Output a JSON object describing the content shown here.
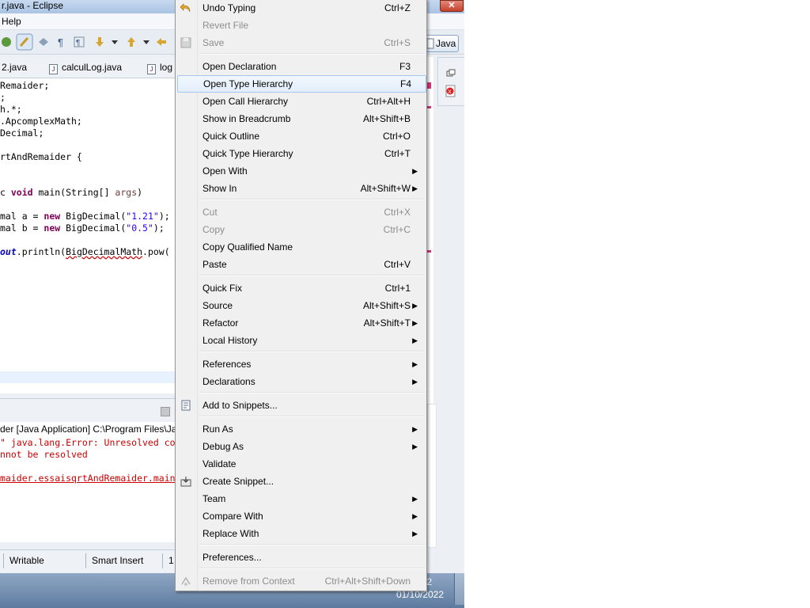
{
  "window": {
    "title": "r.java - Eclipse",
    "close_glyph": "✕"
  },
  "menubar": {
    "help": "Help"
  },
  "toolbar": {
    "perspective_label": "Java"
  },
  "editor_tabs": [
    {
      "label": "2.java"
    },
    {
      "label": "calculLog.java"
    },
    {
      "label": "log"
    }
  ],
  "editor": {
    "lines": [
      "Remaider;",
      ";",
      "h.*;",
      ".ApcomplexMath;",
      "Decimal;",
      "",
      "rtAndRemaider {",
      "",
      "",
      "c void main(String[] args)",
      "",
      "mal a = new BigDecimal(\"1.21\");",
      "mal b = new BigDecimal(\"0.5\");",
      "",
      "out.println(BigDecimalMath.pow("
    ]
  },
  "console": {
    "process": "der [Java Application] C:\\Program Files\\Ja",
    "lines": [
      "\" java.lang.Error: Unresolved co",
      "nnot be resolved",
      "",
      "maider.essaisqrtAndRemaider.main"
    ]
  },
  "statusbar": {
    "writable": "Writable",
    "insert_mode": "Smart Insert",
    "position": "1"
  },
  "clock": {
    "time": "2",
    "date": "01/10/2022"
  },
  "context_menu": {
    "items": [
      {
        "label": "Undo Typing",
        "shortcut": "Ctrl+Z",
        "icon": "undo-icon"
      },
      {
        "label": "Revert File",
        "shortcut": "",
        "disabled": true
      },
      {
        "label": "Save",
        "shortcut": "Ctrl+S",
        "disabled": true,
        "icon": "save-icon"
      },
      {
        "label": "Open Declaration",
        "shortcut": "F3"
      },
      {
        "label": "Open Type Hierarchy",
        "shortcut": "F4",
        "highlighted": true
      },
      {
        "label": "Open Call Hierarchy",
        "shortcut": "Ctrl+Alt+H"
      },
      {
        "label": "Show in Breadcrumb",
        "shortcut": "Alt+Shift+B"
      },
      {
        "label": "Quick Outline",
        "shortcut": "Ctrl+O"
      },
      {
        "label": "Quick Type Hierarchy",
        "shortcut": "Ctrl+T"
      },
      {
        "label": "Open With",
        "shortcut": "",
        "submenu": true
      },
      {
        "label": "Show In",
        "shortcut": "Alt+Shift+W",
        "submenu": true
      },
      {
        "label": "Cut",
        "shortcut": "Ctrl+X",
        "disabled": true
      },
      {
        "label": "Copy",
        "shortcut": "Ctrl+C",
        "disabled": true
      },
      {
        "label": "Copy Qualified Name",
        "shortcut": ""
      },
      {
        "label": "Paste",
        "shortcut": "Ctrl+V"
      },
      {
        "label": "Quick Fix",
        "shortcut": "Ctrl+1"
      },
      {
        "label": "Source",
        "shortcut": "Alt+Shift+S",
        "submenu": true
      },
      {
        "label": "Refactor",
        "shortcut": "Alt+Shift+T",
        "submenu": true
      },
      {
        "label": "Local History",
        "shortcut": "",
        "submenu": true
      },
      {
        "label": "References",
        "shortcut": "",
        "submenu": true
      },
      {
        "label": "Declarations",
        "shortcut": "",
        "submenu": true
      },
      {
        "label": "Add to Snippets...",
        "shortcut": "",
        "icon": "snippet-add-icon"
      },
      {
        "label": "Run As",
        "shortcut": "",
        "submenu": true
      },
      {
        "label": "Debug As",
        "shortcut": "",
        "submenu": true
      },
      {
        "label": "Validate",
        "shortcut": ""
      },
      {
        "label": "Create Snippet...",
        "shortcut": "",
        "icon": "snippet-create-icon"
      },
      {
        "label": "Team",
        "shortcut": "",
        "submenu": true
      },
      {
        "label": "Compare With",
        "shortcut": "",
        "submenu": true
      },
      {
        "label": "Replace With",
        "shortcut": "",
        "submenu": true
      },
      {
        "label": "Preferences...",
        "shortcut": ""
      },
      {
        "label": "Remove from Context",
        "shortcut": "Ctrl+Alt+Shift+Down",
        "disabled": true,
        "icon": "context-remove-icon"
      }
    ],
    "arrow_glyph": "▶"
  }
}
